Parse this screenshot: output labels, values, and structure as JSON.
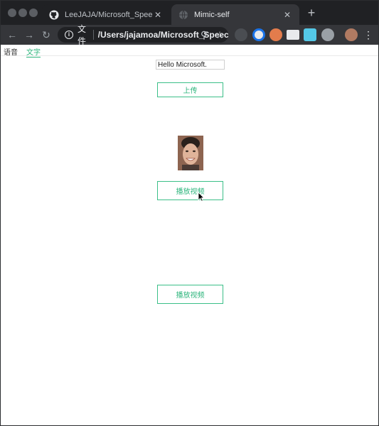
{
  "browser": {
    "tabs": [
      {
        "title": "LeeJAJA/Microsoft_Speech_API",
        "icon": "github-icon"
      },
      {
        "title": "Mimic-self",
        "icon": "globe-icon",
        "active": true
      }
    ],
    "address": {
      "scheme_label": "文件",
      "url": "/Users/jajamoa/Microsoft_Speech_API/index.html"
    },
    "colors": {
      "tab_bg": "#202124",
      "toolbar_bg": "#35363a",
      "accent": "#2db57c"
    }
  },
  "page": {
    "nav": {
      "voice_label": "语音",
      "text_label": "文字"
    },
    "text_input_value": "Hello Microsoft.",
    "upload_label": "上传",
    "play_video_label_1": "播放视频",
    "play_video_label_2": "播放视频",
    "avatar_image": "smiling-face-photo"
  }
}
